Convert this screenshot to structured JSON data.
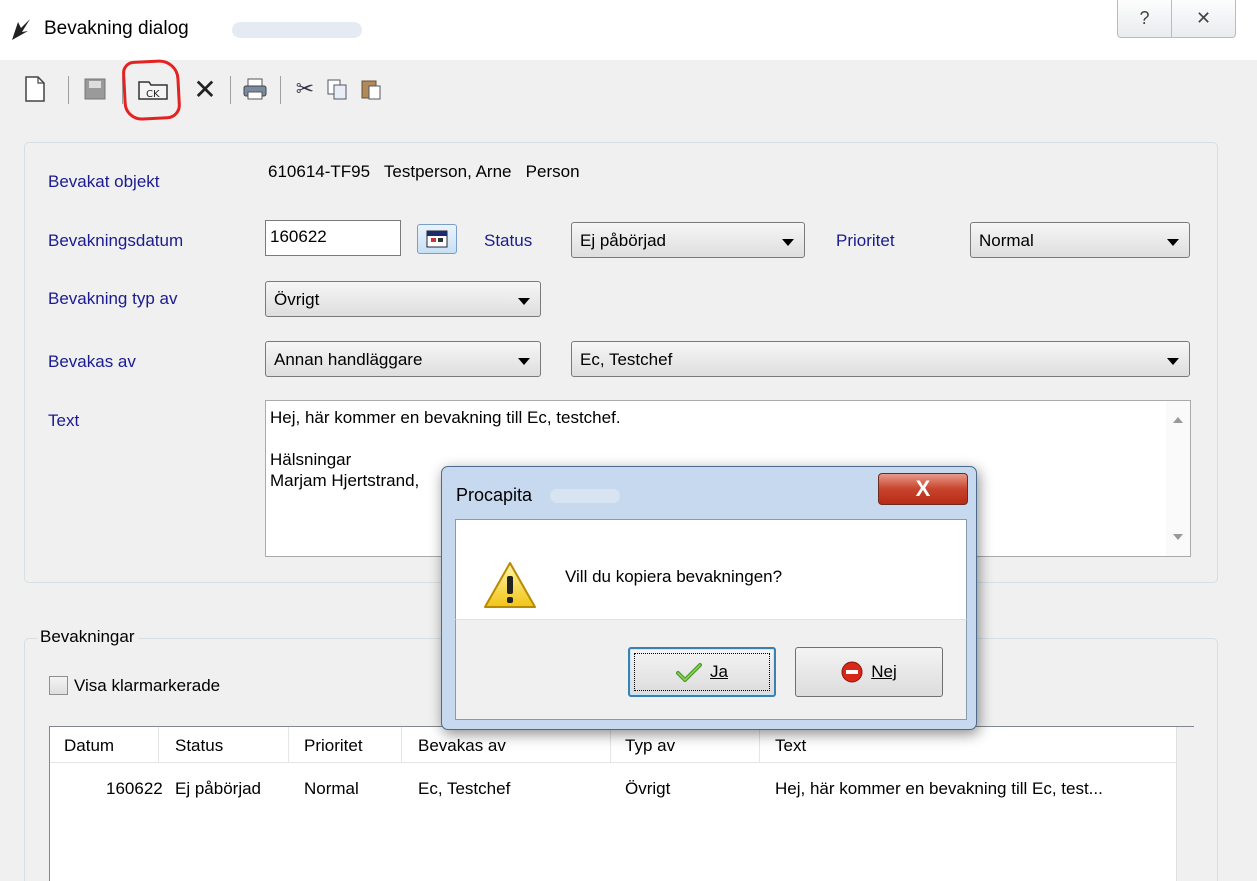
{
  "window": {
    "title": "Bevakning dialog",
    "help_glyph": "?",
    "close_glyph": "✕"
  },
  "toolbar": {
    "items": [
      "new-icon",
      "save-icon",
      "copy-record-icon",
      "delete-icon",
      "print-icon",
      "cut-icon",
      "copy-icon",
      "paste-icon"
    ],
    "copy_record_glyph": "CK",
    "delete_glyph": "✕",
    "cut_glyph": "✂"
  },
  "form": {
    "bevakat_objekt_label": "Bevakat objekt",
    "bevakat_objekt_value": "610614-TF95   Testperson, Arne   Person",
    "bevakningsdatum_label": "Bevakningsdatum",
    "bevakningsdatum_value": "160622",
    "status_label": "Status",
    "status_value": "Ej påbörjad",
    "prioritet_label": "Prioritet",
    "prioritet_value": "Normal",
    "typ_label": "Bevakning typ av",
    "typ_value": "Övrigt",
    "bevakas_av_label": "Bevakas av",
    "bevakas_av_value": "Annan handläggare",
    "handlaggare_value": "Ec, Testchef",
    "text_label": "Text",
    "text_lines": [
      "Hej, här kommer en bevakning till Ec, testchef.",
      "",
      "Hälsningar",
      "Marjam Hjertstrand,"
    ]
  },
  "list": {
    "group_title": "Bevakningar",
    "checkbox_label": "Visa klarmarkerade",
    "headers": [
      "Datum",
      "Status",
      "Prioritet",
      "Bevakas av",
      "Typ av",
      "Text"
    ],
    "rows": [
      [
        "160622",
        "Ej påbörjad",
        "Normal",
        "Ec, Testchef",
        "Övrigt",
        "Hej, här kommer en bevakning till Ec, test..."
      ]
    ]
  },
  "modal": {
    "title": "Procapita",
    "close_glyph": "X",
    "message": "Vill du kopiera bevakningen?",
    "yes_label": "Ja",
    "no_label": "Nej"
  },
  "colors": {
    "label_blue": "#1b1b8f",
    "highlight_red": "#e52222",
    "modal_frame": "#c7d9ee"
  }
}
